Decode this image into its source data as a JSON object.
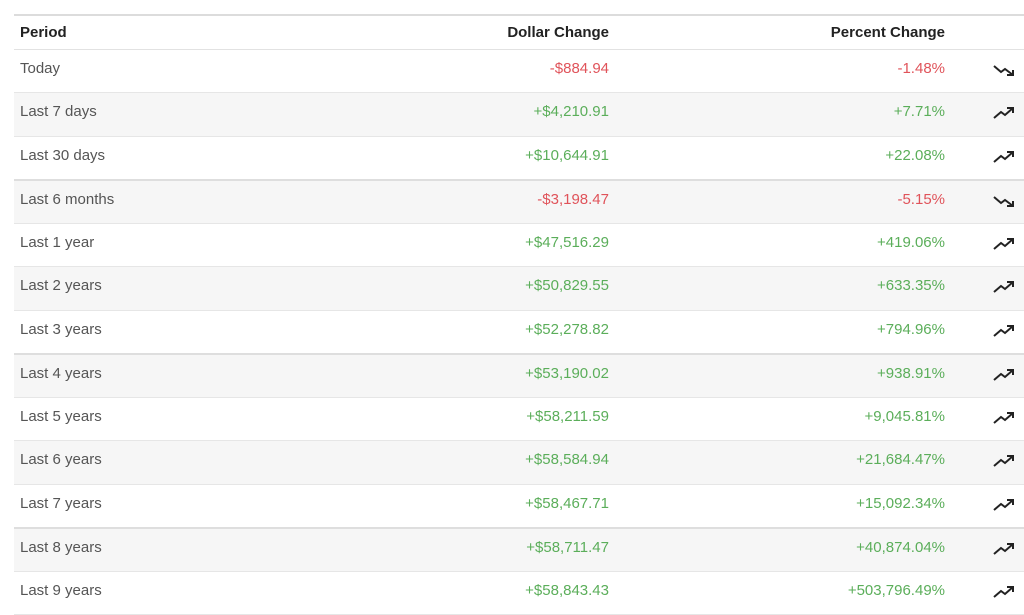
{
  "colors": {
    "negative": "#e0535a",
    "positive": "#5bae5a"
  },
  "headers": {
    "period": "Period",
    "dollar": "Dollar Change",
    "percent": "Percent Change"
  },
  "rows": [
    {
      "period": "Today",
      "dollar": "-$884.94",
      "percent": "-1.48%",
      "direction": "down",
      "icon": "trending-down-icon"
    },
    {
      "period": "Last 7 days",
      "dollar": "+$4,210.91",
      "percent": "+7.71%",
      "direction": "up",
      "icon": "trending-up-icon"
    },
    {
      "period": "Last 30 days",
      "dollar": "+$10,644.91",
      "percent": "+22.08%",
      "direction": "up",
      "icon": "trending-up-icon"
    },
    {
      "period": "Last 6 months",
      "dollar": "-$3,198.47",
      "percent": "-5.15%",
      "direction": "down",
      "icon": "trending-down-icon"
    },
    {
      "period": "Last 1 year",
      "dollar": "+$47,516.29",
      "percent": "+419.06%",
      "direction": "up",
      "icon": "trending-up-icon"
    },
    {
      "period": "Last 2 years",
      "dollar": "+$50,829.55",
      "percent": "+633.35%",
      "direction": "up",
      "icon": "trending-up-icon"
    },
    {
      "period": "Last 3 years",
      "dollar": "+$52,278.82",
      "percent": "+794.96%",
      "direction": "up",
      "icon": "trending-up-icon"
    },
    {
      "period": "Last 4 years",
      "dollar": "+$53,190.02",
      "percent": "+938.91%",
      "direction": "up",
      "icon": "trending-up-icon"
    },
    {
      "period": "Last 5 years",
      "dollar": "+$58,211.59",
      "percent": "+9,045.81%",
      "direction": "up",
      "icon": "trending-up-icon"
    },
    {
      "period": "Last 6 years",
      "dollar": "+$58,584.94",
      "percent": "+21,684.47%",
      "direction": "up",
      "icon": "trending-up-icon"
    },
    {
      "period": "Last 7 years",
      "dollar": "+$58,467.71",
      "percent": "+15,092.34%",
      "direction": "up",
      "icon": "trending-up-icon"
    },
    {
      "period": "Last 8 years",
      "dollar": "+$58,711.47",
      "percent": "+40,874.04%",
      "direction": "up",
      "icon": "trending-up-icon"
    },
    {
      "period": "Last 9 years",
      "dollar": "+$58,843.43",
      "percent": "+503,796.49%",
      "direction": "up",
      "icon": "trending-up-icon"
    }
  ]
}
